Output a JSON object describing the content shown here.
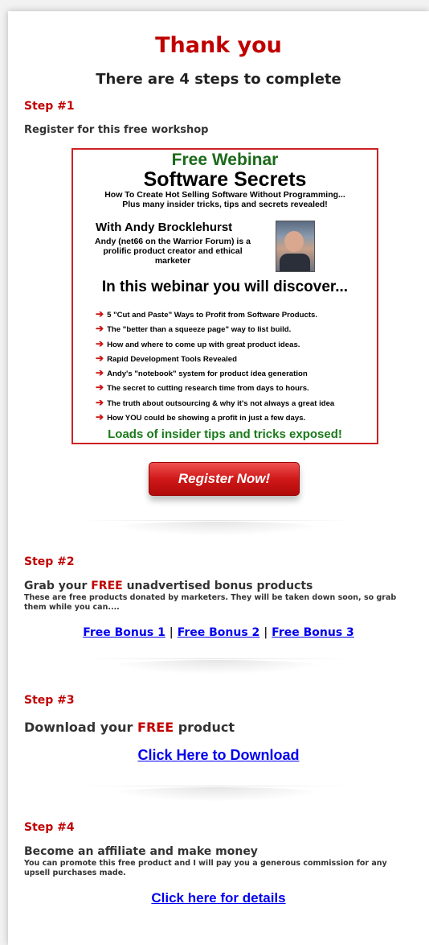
{
  "title": "Thank you",
  "subtitle": "There are 4 steps to complete",
  "step1": {
    "label": "Step #1",
    "heading": "Register for this free workshop",
    "banner": {
      "free_webinar": "Free Webinar",
      "software_secrets": "Software Secrets",
      "how_to": "How To Create Hot Selling Software Without Programming...",
      "plus": "Plus many insider tricks, tips and secrets revealed!",
      "with": "With  Andy Brocklehurst",
      "andy_desc": "Andy (net66 on the Warrior Forum) is a prolific product creator and ethical marketer",
      "discover": "In this webinar you will discover...",
      "items": [
        "5 \"Cut and Paste\" Ways to Profit from Software Products.",
        "The \"better than a squeeze page\" way to list build.",
        "How and where to come up with great product ideas.",
        "Rapid Development Tools Revealed",
        "Andy's \"notebook\" system for product idea generation",
        "The secret to cutting research time from days to hours.",
        "The truth about outsourcing & why it's not always a great idea",
        "How YOU could be showing a profit in just a few days."
      ],
      "loads": "Loads of insider tips and tricks exposed!"
    },
    "register_button": "Register Now!"
  },
  "step2": {
    "label": "Step #2",
    "heading_pre": "Grab your ",
    "heading_free": "FREE",
    "heading_post": " unadvertised bonus products",
    "desc": "These are free products donated by marketers. They will be taken down soon, so grab them while you can....",
    "links": [
      "Free Bonus 1",
      "Free Bonus 2",
      " Free Bonus 3"
    ],
    "separator": "|"
  },
  "step3": {
    "label": "Step #3",
    "heading_pre": "Download your ",
    "heading_free": "FREE",
    "heading_post": " product",
    "link": "Click Here to Download"
  },
  "step4": {
    "label": "Step #4",
    "heading": "Become an affiliate and make money",
    "desc": "You can promote this free product and I will pay you a generous commission for any upsell purchases made.",
    "link": "Click here for details"
  }
}
